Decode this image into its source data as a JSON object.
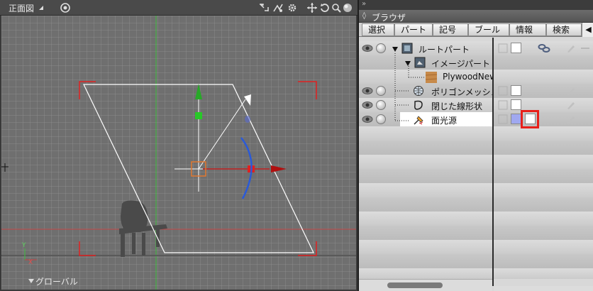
{
  "viewport": {
    "title": "正面図",
    "footer_label": "グローバル",
    "axis_y_label": "Y",
    "axis_x_label": "X",
    "tools": [
      "fit-icon",
      "zoom-icon",
      "settings-icon",
      "move-view-icon",
      "rotate-view-icon",
      "zoom-view-icon",
      "render-sphere-icon"
    ]
  },
  "browser": {
    "title": "ブラウザ",
    "tabs": [
      {
        "label": "選択"
      },
      {
        "label": "パート"
      },
      {
        "label": "記号"
      },
      {
        "label": "ブール"
      },
      {
        "label": "情報"
      },
      {
        "label": "検索"
      }
    ],
    "tree": [
      {
        "label": "ルートパート",
        "icon": "root-part-icon"
      },
      {
        "label": "イメージパート",
        "icon": "image-part-icon"
      },
      {
        "label": "PlywoodNew",
        "icon": "texture-icon"
      },
      {
        "label": "ポリゴンメッシュ",
        "icon": "polygon-mesh-icon"
      },
      {
        "label": "閉じた線形状",
        "icon": "closed-line-icon"
      },
      {
        "label": "面光源",
        "icon": "area-light-icon"
      }
    ]
  },
  "colors": {
    "viewport_bg": "#6f6f6f",
    "selection_red": "#e8201a",
    "light_color_swatch": "#a0a8f0"
  }
}
